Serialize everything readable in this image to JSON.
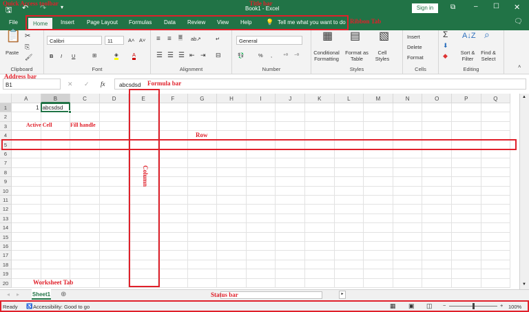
{
  "titlebar": {
    "title": "Book1 - Excel",
    "sign_in": "Sign in"
  },
  "tabs": [
    {
      "label": "File"
    },
    {
      "label": "Home"
    },
    {
      "label": "Insert"
    },
    {
      "label": "Page Layout"
    },
    {
      "label": "Formulas"
    },
    {
      "label": "Data"
    },
    {
      "label": "Review"
    },
    {
      "label": "View"
    },
    {
      "label": "Help"
    }
  ],
  "tell_me": "Tell me what you want to do",
  "ribbon": {
    "clipboard": {
      "label": "Clipboard",
      "paste": "Paste"
    },
    "font": {
      "label": "Font",
      "name": "Calibri",
      "size": "11",
      "bold": "B",
      "italic": "I",
      "underline": "U"
    },
    "alignment": {
      "label": "Alignment"
    },
    "number": {
      "label": "Number",
      "format": "General",
      "percent": "%",
      "comma": ","
    },
    "styles": {
      "label": "Styles",
      "conditional": "Conditional Formatting",
      "format_table": "Format as Table",
      "cell_styles": "Cell Styles"
    },
    "cells": {
      "label": "Cells",
      "insert": "Insert",
      "delete": "Delete",
      "format": "Format"
    },
    "editing": {
      "label": "Editing",
      "sort": "Sort & Filter",
      "find": "Find & Select"
    }
  },
  "formula_bar": {
    "name_box": "B1",
    "value": "abcsdsd",
    "fx": "fx"
  },
  "columns": [
    "A",
    "B",
    "C",
    "D",
    "E",
    "F",
    "G",
    "H",
    "I",
    "J",
    "K",
    "L",
    "M",
    "N",
    "O",
    "P",
    "Q"
  ],
  "rows": [
    "1",
    "2",
    "3",
    "4",
    "5",
    "6",
    "7",
    "8",
    "9",
    "10",
    "11",
    "12",
    "13",
    "14",
    "15",
    "16",
    "17",
    "18",
    "19",
    "20"
  ],
  "cells": {
    "A1": "1",
    "B1": "abcsdsd"
  },
  "sheets": [
    {
      "label": "Sheet1"
    }
  ],
  "status": {
    "ready": "Ready",
    "accessibility": "Accessibility: Good to go",
    "zoom": "100%",
    "zoom_percent": 100
  },
  "annotations": {
    "qat": "Quick Access toolbar",
    "title": "Title bar",
    "ribbon_tab": "Ribbon Tab",
    "address": "Address bar",
    "formula": "Formula bar",
    "active": "Active Cell",
    "fill": "Fill handle",
    "row": "Row",
    "column": "Column",
    "worksheet": "Worksheet Tab",
    "status": "Status bar"
  },
  "colors": {
    "brand": "#217346",
    "annotation": "#e0202a"
  }
}
